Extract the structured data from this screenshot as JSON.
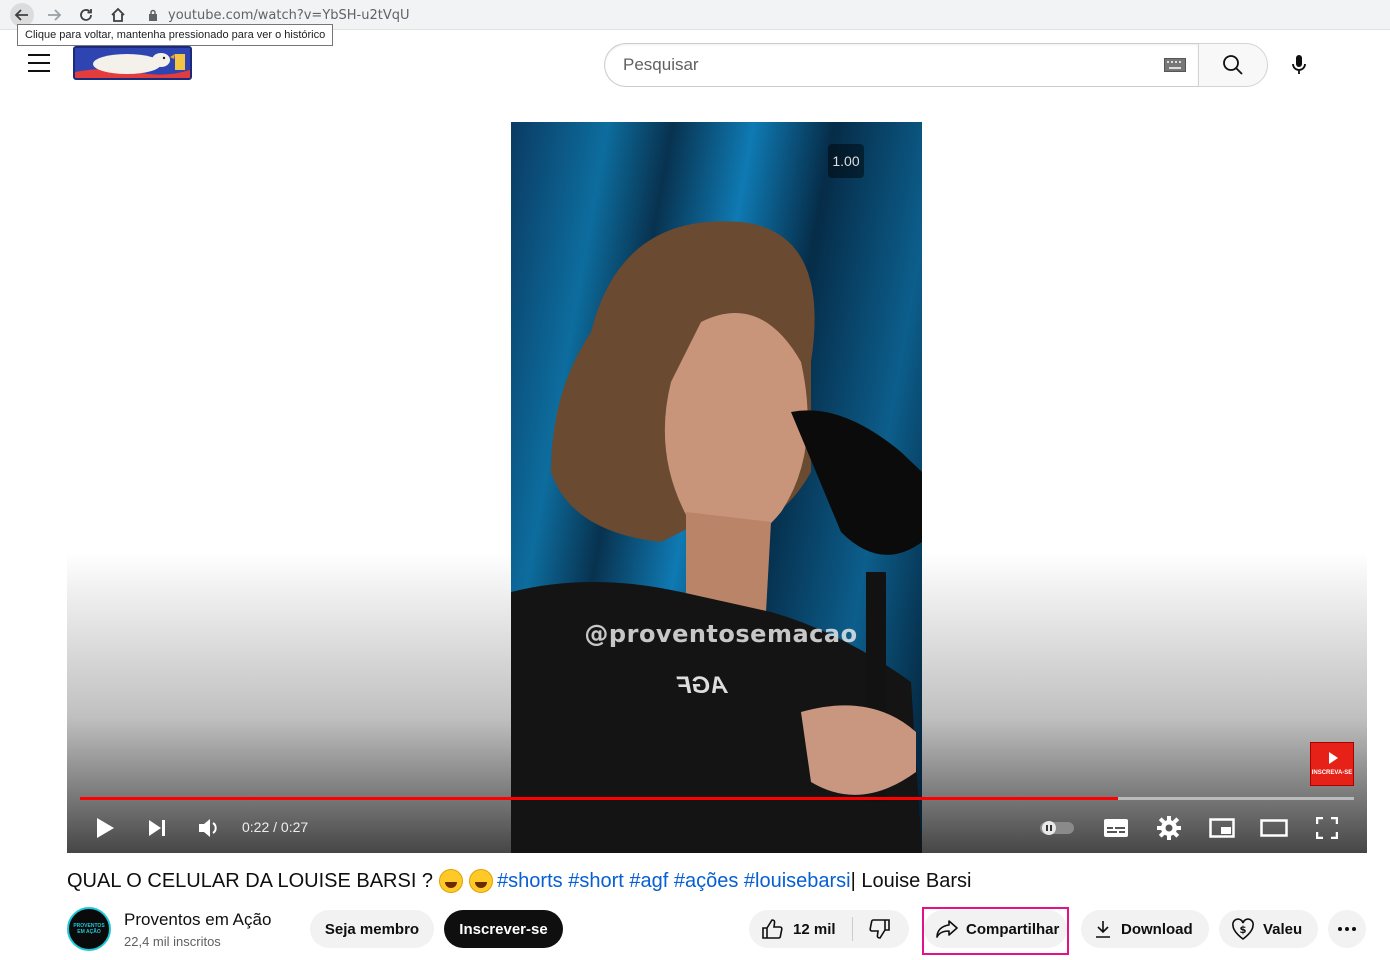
{
  "browser": {
    "url": "youtube.com/watch?v=YbSH-u2tVqU",
    "back_tooltip": "Clique para voltar, mantenha pressionado para ver o histórico"
  },
  "header": {
    "search_placeholder": "Pesquisar"
  },
  "player": {
    "speed_badge": "1.00",
    "watermark": "@proventosemacao",
    "shirt_logo": "AGF",
    "subscribe_card_text": "INSCREVA-SE",
    "time_display": "0:22 / 0:27",
    "progress_fraction": 0.815,
    "progress_color": "#ff0000"
  },
  "video": {
    "title_prefix": "QUAL O CELULAR DA LOUISE BARSI ?",
    "hashtags": "#shorts #short #agf #ações #louisebarsi",
    "title_suffix": " | Louise Barsi"
  },
  "channel": {
    "avatar_text_1": "PROVENTOS",
    "avatar_text_2": "EM AÇÃO",
    "name": "Proventos em Ação",
    "subscribers": "22,4 mil inscritos",
    "member_label": "Seja membro",
    "subscribe_label": "Inscrever-se"
  },
  "actions": {
    "like_count": "12 mil",
    "share_label": "Compartilhar",
    "download_label": "Download",
    "thanks_label": "Valeu"
  },
  "colors": {
    "highlight": "#e3118a",
    "link": "#065fd4",
    "subscribe_bg": "#0f0f0f"
  }
}
